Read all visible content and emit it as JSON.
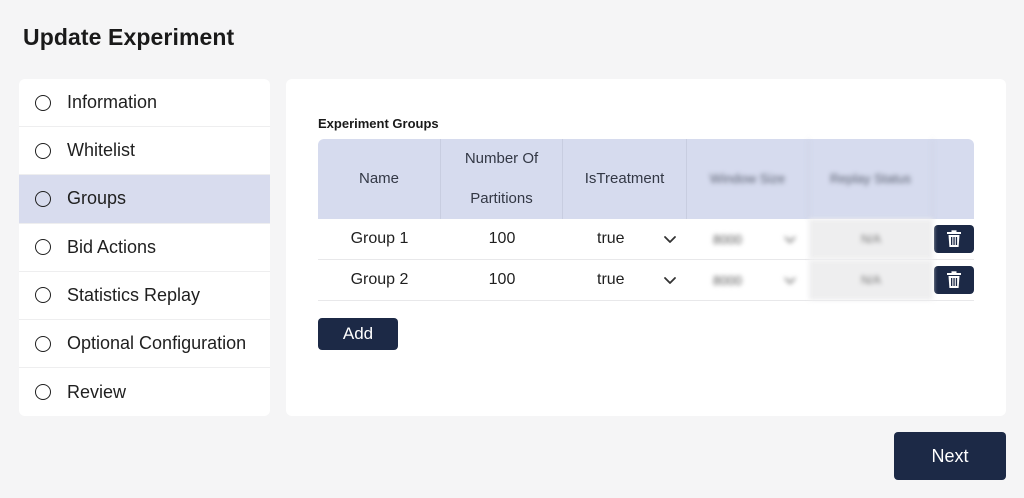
{
  "page": {
    "title": "Update Experiment"
  },
  "sidebar": {
    "items": [
      {
        "label": "Information"
      },
      {
        "label": "Whitelist"
      },
      {
        "label": "Groups"
      },
      {
        "label": "Bid Actions"
      },
      {
        "label": "Statistics Replay"
      },
      {
        "label": "Optional Configuration"
      },
      {
        "label": "Review"
      }
    ],
    "active_item": "Groups"
  },
  "groups_section": {
    "label": "Experiment Groups",
    "columns": {
      "name": "Name",
      "partitions_line1": "Number Of",
      "partitions_line2": "Partitions",
      "is_treatment": "IsTreatment",
      "window_size": "Window Size",
      "replay_status": "Replay Status"
    },
    "rows": [
      {
        "name": "Group 1",
        "partitions": "100",
        "is_treatment": "true",
        "window_size": "8000",
        "replay_status": "N/A"
      },
      {
        "name": "Group 2",
        "partitions": "100",
        "is_treatment": "true",
        "window_size": "8000",
        "replay_status": "N/A"
      }
    ],
    "add_label": "Add"
  },
  "footer": {
    "next_label": "Next"
  },
  "icons": {
    "delete": "trash-icon",
    "dropdown": "chevron-down-icon",
    "step": "radio-circle-icon"
  },
  "colors": {
    "primary": "#1c2946",
    "active_step": "#d8dcee",
    "table_header": "#d6dbee"
  }
}
